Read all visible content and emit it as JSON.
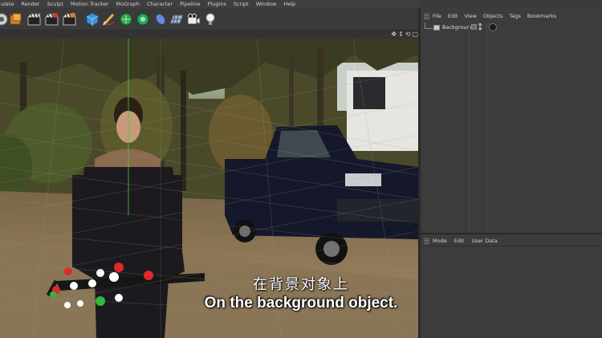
{
  "menu": [
    "ulate",
    "Render",
    "Sculpt",
    "Motion Tracker",
    "MoGraph",
    "Character",
    "Pipeline",
    "Plugins",
    "Script",
    "Window",
    "Help"
  ],
  "objects_panel": {
    "menu": [
      "File",
      "Edit",
      "View",
      "Objects",
      "Tags",
      "Bookmarks"
    ],
    "items": [
      {
        "name": "Background"
      }
    ]
  },
  "attributes_panel": {
    "menu": [
      "Mode",
      "Edit",
      "User Data"
    ]
  },
  "subtitles": {
    "chinese": "在背景对象上",
    "english": "On the background object."
  },
  "colors": {
    "ui_bg": "#3c3c3c",
    "menubar_bg": "#3f3f3f",
    "divider": "#2a2a2a"
  }
}
